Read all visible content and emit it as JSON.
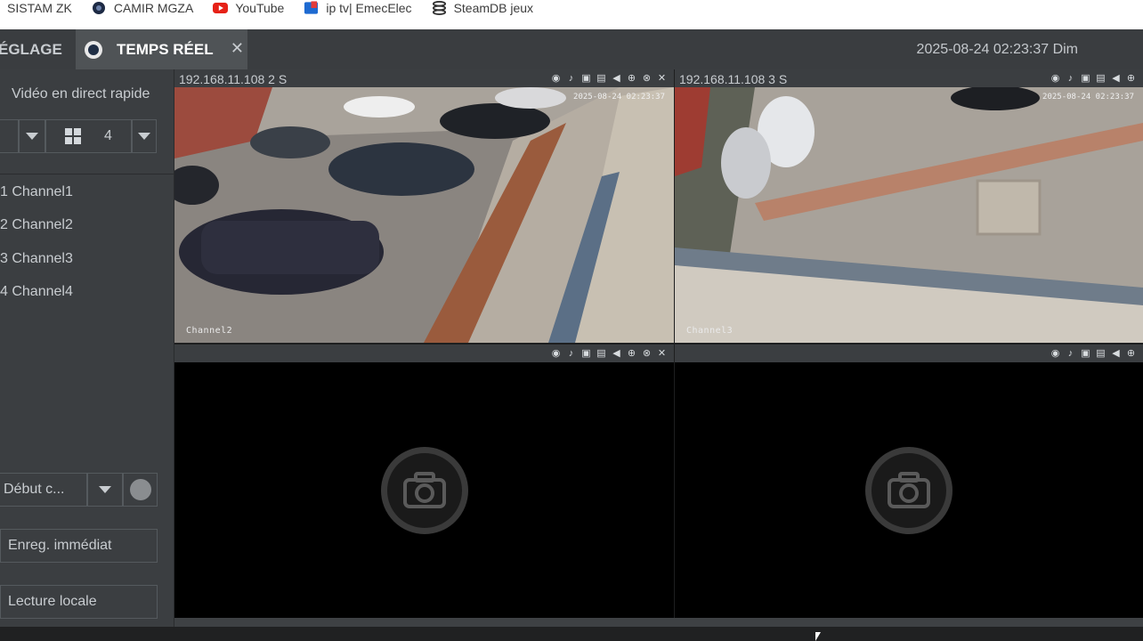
{
  "bookmarks": [
    {
      "label": "SISTAM ZK",
      "icon": "none"
    },
    {
      "label": "CAMIR MGZA",
      "icon": "globe-icon"
    },
    {
      "label": "YouTube",
      "icon": "youtube-icon"
    },
    {
      "label": "ip tv| EmecElec",
      "icon": "tv-icon"
    },
    {
      "label": "SteamDB jeux",
      "icon": "steam-icon"
    }
  ],
  "topbar": {
    "tab_settings": "ÉGLAGE",
    "tab_live": "TEMPS RÉEL",
    "close_glyph": "✕",
    "datetime": "2025-08-24 02:23:37 Dim"
  },
  "sidebar": {
    "title": "Vidéo en direct rapide",
    "layout_value": "4",
    "channels": [
      "1 Channel1",
      "2 Channel2",
      "3 Channel3",
      "4 Channel4"
    ],
    "record_mode": "Début c...",
    "record_now": "Enreg. immédiat",
    "local_playback": "Lecture locale"
  },
  "tiles": [
    {
      "header": "192.168.11.108   2   S",
      "label": "Channel2",
      "timestamp": "2025-08-24 02:23:37"
    },
    {
      "header": "192.168.11.108   3   S",
      "label": "Channel3",
      "timestamp": "2025-08-24 02:23:37"
    },
    {
      "header": "",
      "label": "",
      "timestamp": ""
    },
    {
      "header": "",
      "label": "",
      "timestamp": ""
    }
  ],
  "colors": {
    "panel_bg": "#3b3e41",
    "accent_tab": "#4f5356",
    "text": "#c8ccd0"
  }
}
